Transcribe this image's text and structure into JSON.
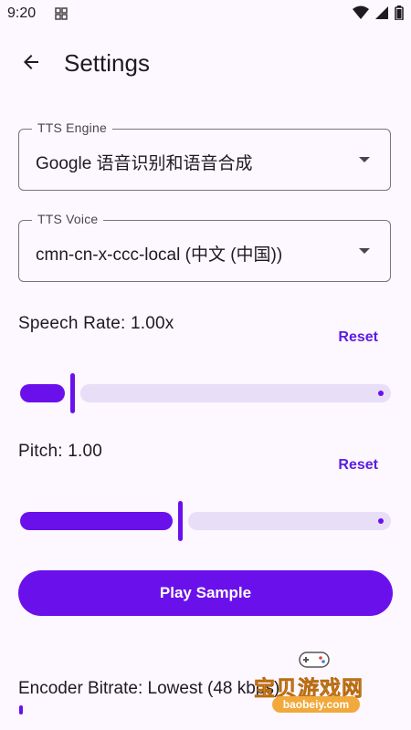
{
  "status_bar": {
    "time": "9:20"
  },
  "header": {
    "title": "Settings"
  },
  "tts_engine": {
    "label": "TTS Engine",
    "value": "Google 语音识别和语音合成"
  },
  "tts_voice": {
    "label": "TTS Voice",
    "value": "cmn-cn-x-ccc-local (中文 (中国))"
  },
  "speech_rate": {
    "title": "Speech Rate: 1.00x",
    "reset_label": "Reset",
    "level": 0.14
  },
  "pitch": {
    "title": "Pitch: 1.00",
    "reset_label": "Reset",
    "level": 0.43
  },
  "play_button": {
    "label": "Play Sample"
  },
  "encoder": {
    "title": "Encoder Bitrate: Lowest (48 kbps)"
  },
  "watermark": {
    "text": "宝贝游戏网",
    "url": "baobeiy.com"
  },
  "colors": {
    "accent": "#6A11EB",
    "track": "#E8DEF8",
    "background": "#FDF7FF"
  },
  "icons": [
    "grid-icon",
    "wifi-icon",
    "signal-icon",
    "battery-icon",
    "arrow-back-icon",
    "dropdown-arrow-icon"
  ]
}
